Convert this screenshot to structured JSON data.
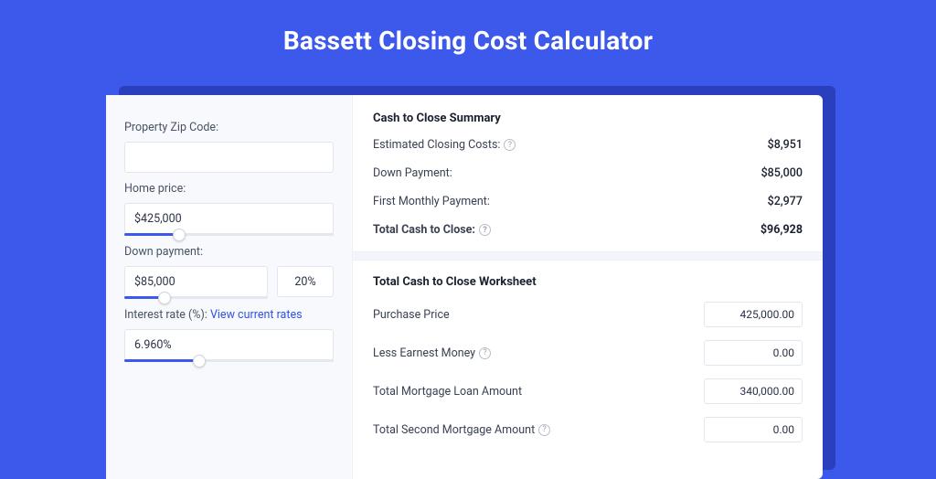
{
  "page": {
    "title": "Bassett Closing Cost Calculator"
  },
  "left": {
    "zip_label": "Property Zip Code:",
    "zip_value": "",
    "price_label": "Home price:",
    "price_value": "$425,000",
    "price_slider_pct": 26,
    "down_label": "Down payment:",
    "down_value": "$85,000",
    "down_pct_value": "20%",
    "down_slider_pct": 28,
    "rate_label": "Interest rate (%): ",
    "rate_link": "View current rates",
    "rate_value": "6.960%",
    "rate_slider_pct": 36
  },
  "summary": {
    "title": "Cash to Close Summary",
    "rows": [
      {
        "label": "Estimated Closing Costs:",
        "help": true,
        "value": "$8,951"
      },
      {
        "label": "Down Payment:",
        "help": false,
        "value": "$85,000"
      },
      {
        "label": "First Monthly Payment:",
        "help": false,
        "value": "$2,977"
      }
    ],
    "total_label": "Total Cash to Close:",
    "total_value": "$96,928"
  },
  "worksheet": {
    "title": "Total Cash to Close Worksheet",
    "rows": [
      {
        "label": "Purchase Price",
        "help": false,
        "value": "425,000.00"
      },
      {
        "label": "Less Earnest Money",
        "help": true,
        "value": "0.00"
      },
      {
        "label": "Total Mortgage Loan Amount",
        "help": false,
        "value": "340,000.00"
      },
      {
        "label": "Total Second Mortgage Amount",
        "help": true,
        "value": "0.00"
      }
    ]
  }
}
